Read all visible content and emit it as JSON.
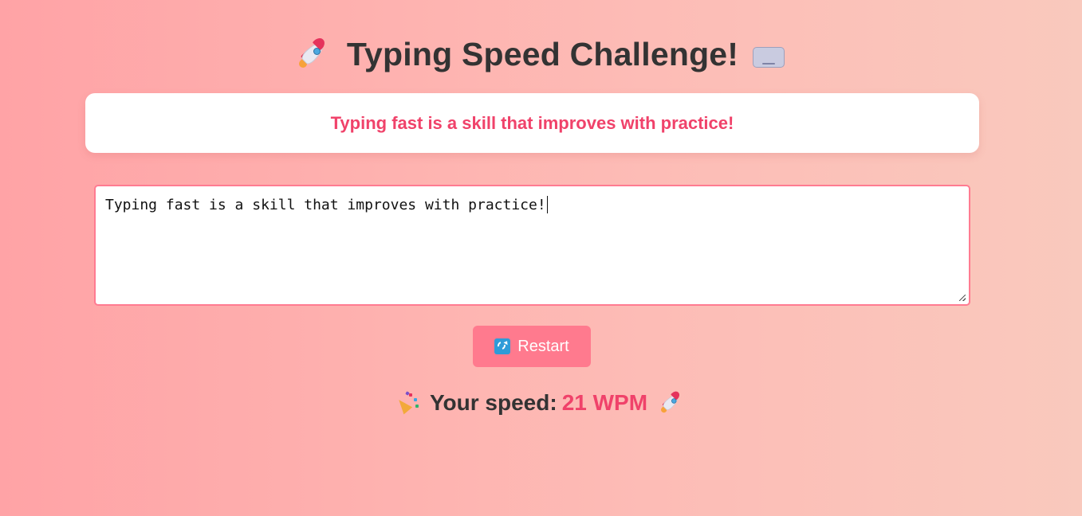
{
  "header": {
    "title": "Typing Speed Challenge!",
    "left_icon": "rocket-icon",
    "right_icon": "keyboard-icon"
  },
  "quote": {
    "text": "Typing fast is a skill that improves with practice!"
  },
  "input": {
    "value": "Typing fast is a skill that improves with practice!",
    "placeholder": ""
  },
  "controls": {
    "restart_label": "Restart",
    "restart_icon": "refresh-icon"
  },
  "result": {
    "label": "Your speed:",
    "value": "21 WPM",
    "left_icon": "party-popper-icon",
    "right_icon": "rocket-icon"
  },
  "colors": {
    "accent": "#f0426a",
    "button": "#ff7a8e",
    "input_border": "#ff7b91",
    "background_start": "#ffa3a6",
    "background_end": "#f9c9bd",
    "text": "#333333"
  }
}
